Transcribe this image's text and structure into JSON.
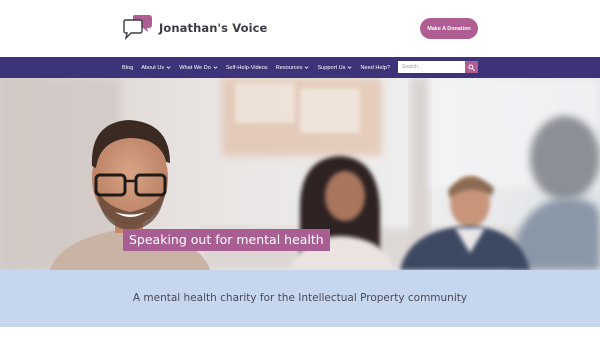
{
  "header": {
    "logo_text": "Jonathan's Voice",
    "donate_label": "Make A Donation"
  },
  "nav": {
    "items": [
      {
        "label": "Blog",
        "has_dropdown": false
      },
      {
        "label": "About Us",
        "has_dropdown": true
      },
      {
        "label": "What We Do",
        "has_dropdown": true
      },
      {
        "label": "Self-Help-Videos",
        "has_dropdown": false
      },
      {
        "label": "Resources",
        "has_dropdown": true
      },
      {
        "label": "Support Us",
        "has_dropdown": true
      },
      {
        "label": "Need Help?",
        "has_dropdown": false
      }
    ],
    "search_placeholder": "Search..."
  },
  "hero": {
    "title": "Speaking out for mental health"
  },
  "tagline": {
    "text": "A mental health charity for the Intellectual Property community"
  },
  "colors": {
    "nav_bg": "#3c3378",
    "accent": "#b05d93",
    "band_bg": "#c7d6ef",
    "logo_text": "#3c3c46"
  },
  "icons": {
    "logo": "speech-bubbles-logo-icon",
    "search": "search-icon",
    "dropdown": "chevron-down-icon"
  }
}
